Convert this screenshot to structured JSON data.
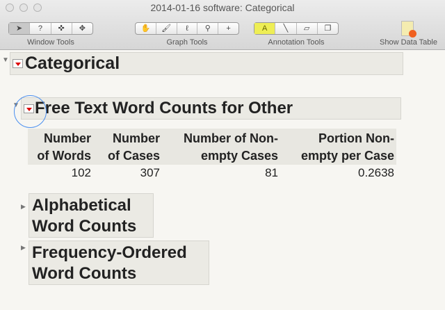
{
  "window": {
    "title": "2014-01-16 software: Categorical"
  },
  "toolbar": {
    "window_tools": {
      "label": "Window Tools",
      "icons": [
        "arrow-icon",
        "help-icon",
        "crosshair-icon",
        "move-icon"
      ]
    },
    "graph_tools": {
      "label": "Graph Tools",
      "icons": [
        "hand-icon",
        "brush-icon",
        "lasso-icon",
        "magnifier-icon",
        "crosshair-xy-icon"
      ]
    },
    "annotation_tools": {
      "label": "Annotation Tools",
      "icons": [
        "annotate-icon",
        "line-icon",
        "polygon-icon",
        "simple-shape-icon"
      ]
    },
    "show_data_table": {
      "label": "Show Data Table"
    }
  },
  "report": {
    "title": "Categorical",
    "section": {
      "title": "Free Text Word Counts for Other",
      "columns": [
        [
          "Number",
          "of Words"
        ],
        [
          "Number",
          "of Cases"
        ],
        [
          "Number of Non-",
          "empty Cases"
        ],
        [
          "Portion Non-",
          "empty per Case"
        ]
      ],
      "values": [
        "102",
        "307",
        "81",
        "0.2638"
      ]
    },
    "closed_sections": [
      [
        "Alphabetical",
        "Word Counts"
      ],
      [
        "Frequency-Ordered",
        "Word Counts"
      ]
    ]
  },
  "colors": {
    "highlight_circle": "#4a8ff0",
    "menu_arrow": "#dd0000"
  }
}
